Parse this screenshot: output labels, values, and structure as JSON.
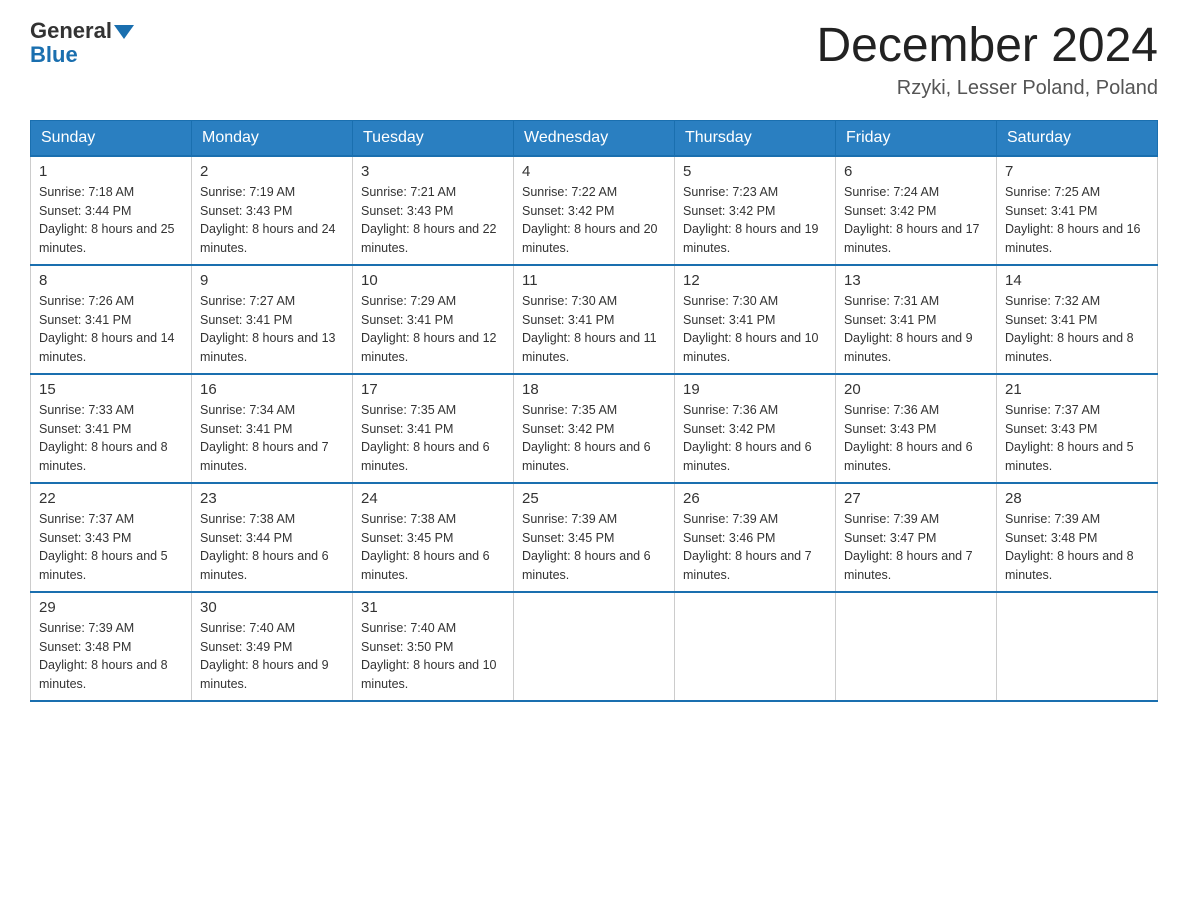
{
  "logo": {
    "general": "General",
    "blue": "Blue"
  },
  "header": {
    "title": "December 2024",
    "location": "Rzyki, Lesser Poland, Poland"
  },
  "weekdays": [
    "Sunday",
    "Monday",
    "Tuesday",
    "Wednesday",
    "Thursday",
    "Friday",
    "Saturday"
  ],
  "weeks": [
    [
      {
        "day": "1",
        "sunrise": "7:18 AM",
        "sunset": "3:44 PM",
        "daylight": "8 hours and 25 minutes."
      },
      {
        "day": "2",
        "sunrise": "7:19 AM",
        "sunset": "3:43 PM",
        "daylight": "8 hours and 24 minutes."
      },
      {
        "day": "3",
        "sunrise": "7:21 AM",
        "sunset": "3:43 PM",
        "daylight": "8 hours and 22 minutes."
      },
      {
        "day": "4",
        "sunrise": "7:22 AM",
        "sunset": "3:42 PM",
        "daylight": "8 hours and 20 minutes."
      },
      {
        "day": "5",
        "sunrise": "7:23 AM",
        "sunset": "3:42 PM",
        "daylight": "8 hours and 19 minutes."
      },
      {
        "day": "6",
        "sunrise": "7:24 AM",
        "sunset": "3:42 PM",
        "daylight": "8 hours and 17 minutes."
      },
      {
        "day": "7",
        "sunrise": "7:25 AM",
        "sunset": "3:41 PM",
        "daylight": "8 hours and 16 minutes."
      }
    ],
    [
      {
        "day": "8",
        "sunrise": "7:26 AM",
        "sunset": "3:41 PM",
        "daylight": "8 hours and 14 minutes."
      },
      {
        "day": "9",
        "sunrise": "7:27 AM",
        "sunset": "3:41 PM",
        "daylight": "8 hours and 13 minutes."
      },
      {
        "day": "10",
        "sunrise": "7:29 AM",
        "sunset": "3:41 PM",
        "daylight": "8 hours and 12 minutes."
      },
      {
        "day": "11",
        "sunrise": "7:30 AM",
        "sunset": "3:41 PM",
        "daylight": "8 hours and 11 minutes."
      },
      {
        "day": "12",
        "sunrise": "7:30 AM",
        "sunset": "3:41 PM",
        "daylight": "8 hours and 10 minutes."
      },
      {
        "day": "13",
        "sunrise": "7:31 AM",
        "sunset": "3:41 PM",
        "daylight": "8 hours and 9 minutes."
      },
      {
        "day": "14",
        "sunrise": "7:32 AM",
        "sunset": "3:41 PM",
        "daylight": "8 hours and 8 minutes."
      }
    ],
    [
      {
        "day": "15",
        "sunrise": "7:33 AM",
        "sunset": "3:41 PM",
        "daylight": "8 hours and 8 minutes."
      },
      {
        "day": "16",
        "sunrise": "7:34 AM",
        "sunset": "3:41 PM",
        "daylight": "8 hours and 7 minutes."
      },
      {
        "day": "17",
        "sunrise": "7:35 AM",
        "sunset": "3:41 PM",
        "daylight": "8 hours and 6 minutes."
      },
      {
        "day": "18",
        "sunrise": "7:35 AM",
        "sunset": "3:42 PM",
        "daylight": "8 hours and 6 minutes."
      },
      {
        "day": "19",
        "sunrise": "7:36 AM",
        "sunset": "3:42 PM",
        "daylight": "8 hours and 6 minutes."
      },
      {
        "day": "20",
        "sunrise": "7:36 AM",
        "sunset": "3:43 PM",
        "daylight": "8 hours and 6 minutes."
      },
      {
        "day": "21",
        "sunrise": "7:37 AM",
        "sunset": "3:43 PM",
        "daylight": "8 hours and 5 minutes."
      }
    ],
    [
      {
        "day": "22",
        "sunrise": "7:37 AM",
        "sunset": "3:43 PM",
        "daylight": "8 hours and 5 minutes."
      },
      {
        "day": "23",
        "sunrise": "7:38 AM",
        "sunset": "3:44 PM",
        "daylight": "8 hours and 6 minutes."
      },
      {
        "day": "24",
        "sunrise": "7:38 AM",
        "sunset": "3:45 PM",
        "daylight": "8 hours and 6 minutes."
      },
      {
        "day": "25",
        "sunrise": "7:39 AM",
        "sunset": "3:45 PM",
        "daylight": "8 hours and 6 minutes."
      },
      {
        "day": "26",
        "sunrise": "7:39 AM",
        "sunset": "3:46 PM",
        "daylight": "8 hours and 7 minutes."
      },
      {
        "day": "27",
        "sunrise": "7:39 AM",
        "sunset": "3:47 PM",
        "daylight": "8 hours and 7 minutes."
      },
      {
        "day": "28",
        "sunrise": "7:39 AM",
        "sunset": "3:48 PM",
        "daylight": "8 hours and 8 minutes."
      }
    ],
    [
      {
        "day": "29",
        "sunrise": "7:39 AM",
        "sunset": "3:48 PM",
        "daylight": "8 hours and 8 minutes."
      },
      {
        "day": "30",
        "sunrise": "7:40 AM",
        "sunset": "3:49 PM",
        "daylight": "8 hours and 9 minutes."
      },
      {
        "day": "31",
        "sunrise": "7:40 AM",
        "sunset": "3:50 PM",
        "daylight": "8 hours and 10 minutes."
      },
      null,
      null,
      null,
      null
    ]
  ]
}
